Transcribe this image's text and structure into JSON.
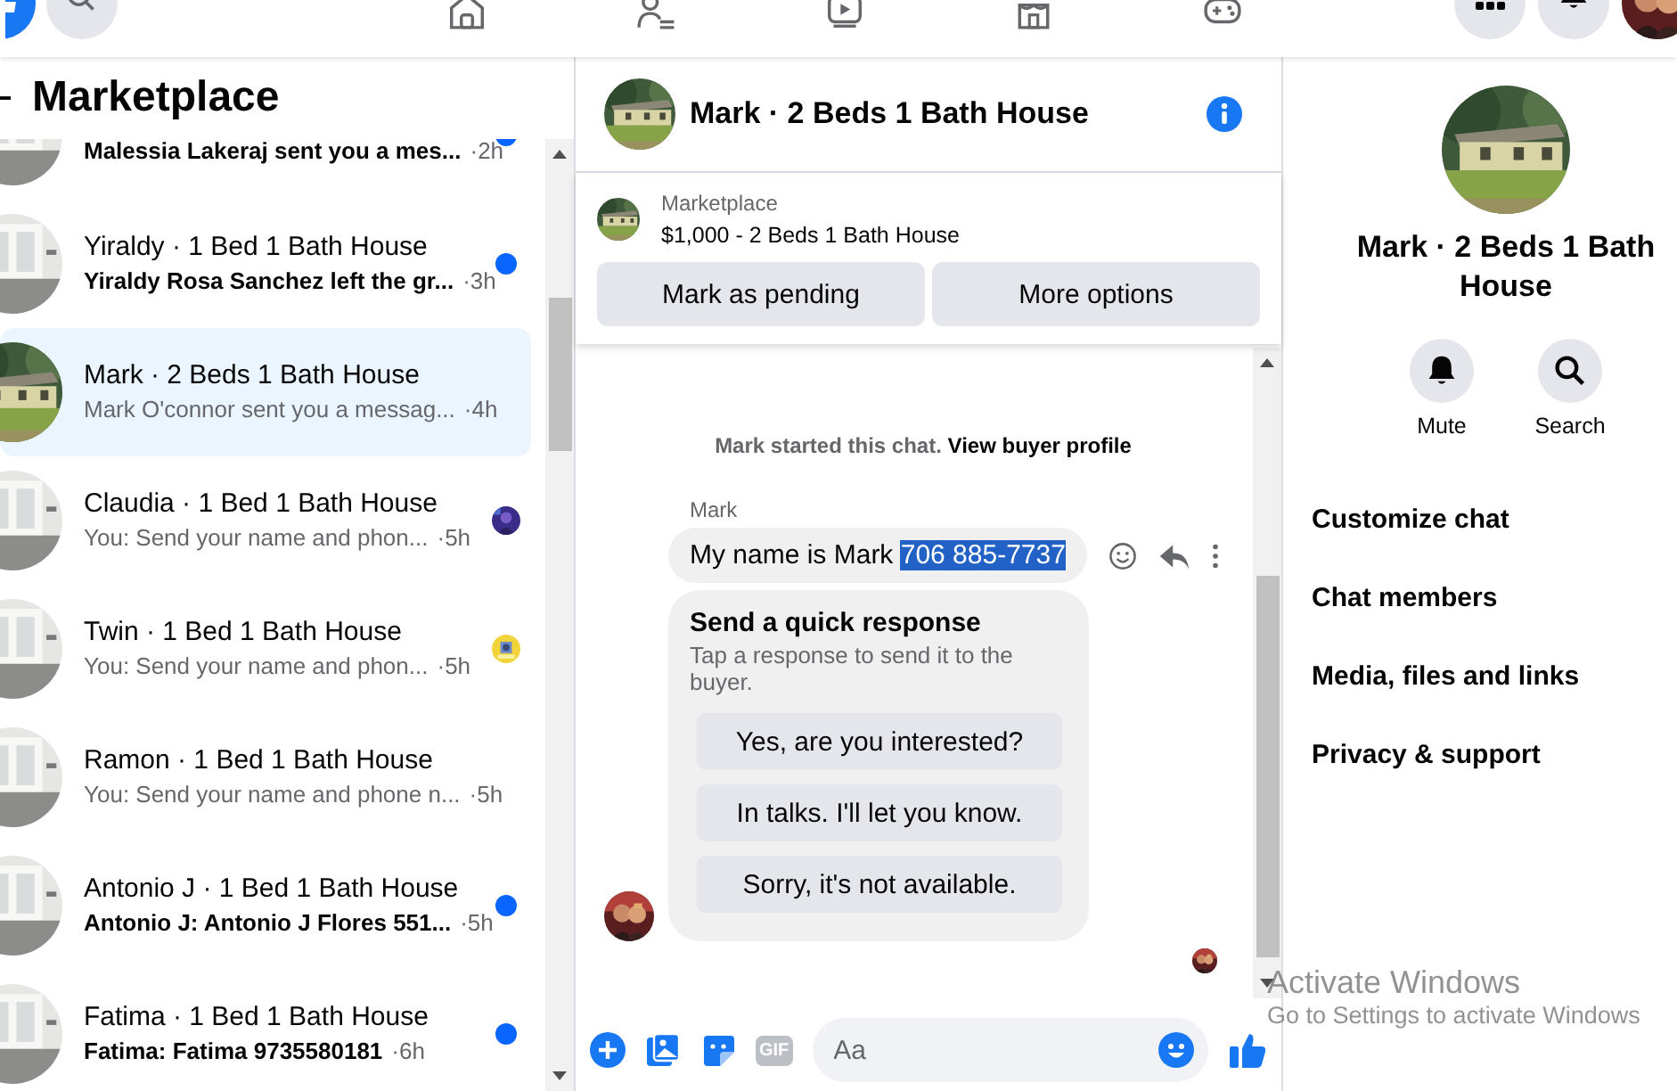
{
  "sidebar": {
    "title": "Marketplace",
    "conversations": [
      {
        "preview": "Malessia Lakeraj sent you a mes...",
        "time": "·2h",
        "unread": true,
        "seen": false,
        "selected": false,
        "clipped": true
      },
      {
        "title": "Yiraldy · 1 Bed 1 Bath House",
        "preview": "Yiraldy Rosa Sanchez left the gr...",
        "time": "·3h",
        "unread": true,
        "seen": false,
        "selected": false
      },
      {
        "title": "Mark · 2 Beds 1 Bath House",
        "preview": "Mark O'connor sent you a messag...",
        "time": "·4h",
        "unread": false,
        "seen": false,
        "selected": true
      },
      {
        "title": "Claudia · 1 Bed 1 Bath House",
        "preview": "You: Send your name and phon...",
        "time": "·5h",
        "unread": false,
        "seen": true,
        "selected": false
      },
      {
        "title": "Twin · 1 Bed 1 Bath House",
        "preview": "You: Send your name and phon...",
        "time": "·5h",
        "unread": false,
        "seen": true,
        "selected": false
      },
      {
        "title": "Ramon · 1 Bed 1 Bath House",
        "preview": "You: Send your name and phone n...",
        "time": "·5h",
        "unread": false,
        "seen": false,
        "selected": false
      },
      {
        "title": "Antonio J · 1 Bed 1 Bath House",
        "preview": "Antonio J: Antonio J Flores 551...",
        "time": "·5h",
        "unread": true,
        "seen": false,
        "selected": false
      },
      {
        "title": "Fatima · 1 Bed 1 Bath House",
        "preview": "Fatima: Fatima 9735580181",
        "time": "·6h",
        "unread": true,
        "seen": false,
        "selected": false
      }
    ]
  },
  "chat": {
    "title": "Mark · 2 Beds 1 Bath House",
    "listing": {
      "label": "Marketplace",
      "title": "$1,000 - 2 Beds 1 Bath House",
      "buttons": [
        "Mark as pending",
        "More options"
      ]
    },
    "notice": {
      "text": "Mark started this chat.",
      "link": "View buyer profile"
    },
    "message": {
      "sender": "Mark",
      "parts": [
        {
          "text": "My name is Mark",
          "highlighted": false
        },
        {
          "text": "706 885-7737",
          "highlighted": true
        }
      ]
    },
    "quick_response": {
      "title": "Send a quick response",
      "hint": "Tap a response to send it to the buyer.",
      "options": [
        "Yes, are you interested?",
        "In talks. I'll let you know.",
        "Sorry, it's not available."
      ]
    },
    "composer": {
      "gif": "GIF",
      "placeholder": "Aa"
    }
  },
  "info_panel": {
    "title": "Mark · 2 Beds 1 Bath House",
    "actions": [
      {
        "label": "Mute",
        "kind": "bell"
      },
      {
        "label": "Search",
        "kind": "search"
      }
    ],
    "menu": [
      "Customize chat",
      "Chat members",
      "Media, files and links",
      "Privacy & support"
    ]
  },
  "os_overlay": {
    "title": "Activate Windows",
    "subtitle": "Go to Settings to activate Windows"
  }
}
